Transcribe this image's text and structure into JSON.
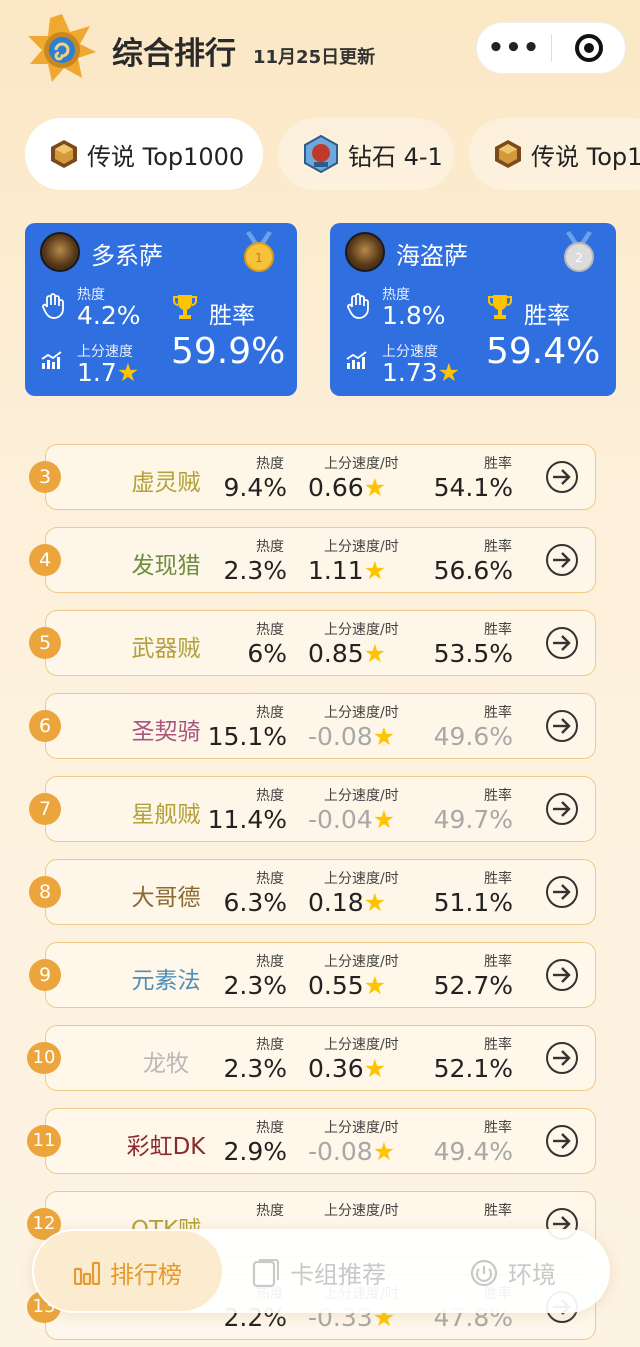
{
  "header": {
    "title": "综合排行",
    "subtitle": "11月25日更新",
    "more_label": "•••"
  },
  "tabs": [
    {
      "label": "传说 Top1000",
      "icon": "legend-hex-icon",
      "active": true
    },
    {
      "label": "钻石 4-1",
      "icon": "diamond-rank-icon",
      "active": false
    },
    {
      "label": "传说 Top1",
      "icon": "legend-hex-icon",
      "active": false
    }
  ],
  "top_cards": [
    {
      "name": "多系萨",
      "heat_label": "热度",
      "heat": "4.2%",
      "speed_label": "上分速度",
      "speed": "1.7",
      "win_label": "胜率",
      "win": "59.9%",
      "medal": "1"
    },
    {
      "name": "海盗萨",
      "heat_label": "热度",
      "heat": "1.8%",
      "speed_label": "上分速度",
      "speed": "1.73",
      "win_label": "胜率",
      "win": "59.4%",
      "medal": "2"
    }
  ],
  "list_labels": {
    "heat": "热度",
    "speed": "上分速度/时",
    "win": "胜率"
  },
  "rows": [
    {
      "rank": "3",
      "name": "虚灵贼",
      "name_color": "#b3a13a",
      "heat": "9.4%",
      "speed": "0.66",
      "win": "54.1%",
      "neg": false
    },
    {
      "rank": "4",
      "name": "发现猎",
      "name_color": "#6e8d3e",
      "heat": "2.3%",
      "speed": "1.11",
      "win": "56.6%",
      "neg": false
    },
    {
      "rank": "5",
      "name": "武器贼",
      "name_color": "#b3a13a",
      "heat": "6%",
      "speed": "0.85",
      "win": "53.5%",
      "neg": false
    },
    {
      "rank": "6",
      "name": "圣契骑",
      "name_color": "#a8567e",
      "heat": "15.1%",
      "speed": "-0.08",
      "win": "49.6%",
      "neg": true
    },
    {
      "rank": "7",
      "name": "星舰贼",
      "name_color": "#b3a13a",
      "heat": "11.4%",
      "speed": "-0.04",
      "win": "49.7%",
      "neg": true
    },
    {
      "rank": "8",
      "name": "大哥德",
      "name_color": "#8a6a2e",
      "heat": "6.3%",
      "speed": "0.18",
      "win": "51.1%",
      "neg": false
    },
    {
      "rank": "9",
      "name": "元素法",
      "name_color": "#4f8fb8",
      "heat": "2.3%",
      "speed": "0.55",
      "win": "52.7%",
      "neg": false
    },
    {
      "rank": "10",
      "name": "龙牧",
      "name_color": "#b8b8b8",
      "heat": "2.3%",
      "speed": "0.36",
      "win": "52.1%",
      "neg": false
    },
    {
      "rank": "11",
      "name": "彩虹DK",
      "name_color": "#8a2a2a",
      "heat": "2.9%",
      "speed": "-0.08",
      "win": "49.4%",
      "neg": true
    },
    {
      "rank": "12",
      "name": "OTK贼",
      "name_color": "#b3a13a",
      "heat": "",
      "speed": "",
      "win": "",
      "neg": false
    },
    {
      "rank": "13",
      "name": "",
      "name_color": "#222",
      "heat": "2.2%",
      "speed": "-0.33",
      "win": "47.8%",
      "neg": true
    }
  ],
  "bottom_nav": [
    {
      "label": "排行榜",
      "active": true,
      "icon": "bar-chart-icon"
    },
    {
      "label": "卡组推荐",
      "active": false,
      "icon": "card-icon"
    },
    {
      "label": "环境",
      "active": false,
      "icon": "power-icon"
    }
  ],
  "colors": {
    "accent": "#eba53c",
    "card_blue": "#2f6fe0",
    "star": "#ffc400"
  }
}
